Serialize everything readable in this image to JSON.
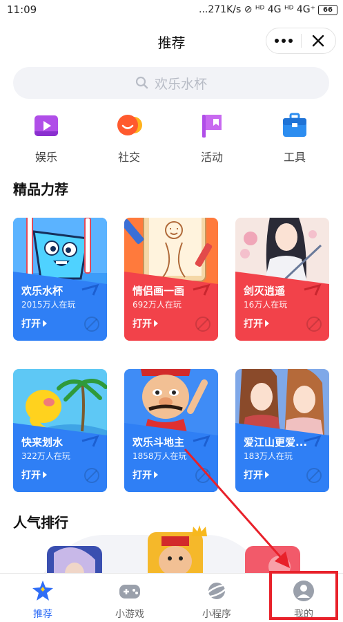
{
  "status_bar": {
    "time": "11:09",
    "right": "...271K/s ⊘ ᴴᴰ 4G ᴴᴰ 4G⁺",
    "battery": "66"
  },
  "header": {
    "title": "推荐"
  },
  "search": {
    "placeholder": "欢乐水杯"
  },
  "categories": [
    {
      "label": "娱乐",
      "icon": "play-icon"
    },
    {
      "label": "社交",
      "icon": "chat-bubble-icon"
    },
    {
      "label": "活动",
      "icon": "flag-icon"
    },
    {
      "label": "工具",
      "icon": "toolbox-icon"
    }
  ],
  "featured": {
    "title": "精品力荐",
    "games": [
      {
        "name": "欢乐水杯",
        "plays": "2015万人在玩",
        "open": "打开",
        "color": "#2f7ff5"
      },
      {
        "name": "情侣画一画",
        "plays": "692万人在玩",
        "open": "打开",
        "color": "#f2424a"
      },
      {
        "name": "剑灭逍遥",
        "plays": "16万人在玩",
        "open": "打开",
        "color": "#f2424a"
      },
      {
        "name": "快来划水",
        "plays": "322万人在玩",
        "open": "打开",
        "color": "#2f7ff5"
      },
      {
        "name": "欢乐斗地主",
        "plays": "1858万人在玩",
        "open": "打开",
        "color": "#2f7ff5"
      },
      {
        "name": "爱江山更爱...",
        "plays": "183万人在玩",
        "open": "打开",
        "color": "#2f7ff5"
      }
    ]
  },
  "ranking": {
    "title": "人气排行"
  },
  "tabbar": {
    "items": [
      {
        "label": "推荐",
        "icon": "star-icon",
        "active": true
      },
      {
        "label": "小游戏",
        "icon": "gamepad-icon",
        "active": false
      },
      {
        "label": "小程序",
        "icon": "planet-icon",
        "active": false
      },
      {
        "label": "我的",
        "icon": "user-icon",
        "active": false
      }
    ]
  },
  "colors": {
    "accent": "#2f6df6",
    "highlight": "#e8212a",
    "card_blue": "#2f7ff5",
    "card_red": "#f2424a"
  }
}
